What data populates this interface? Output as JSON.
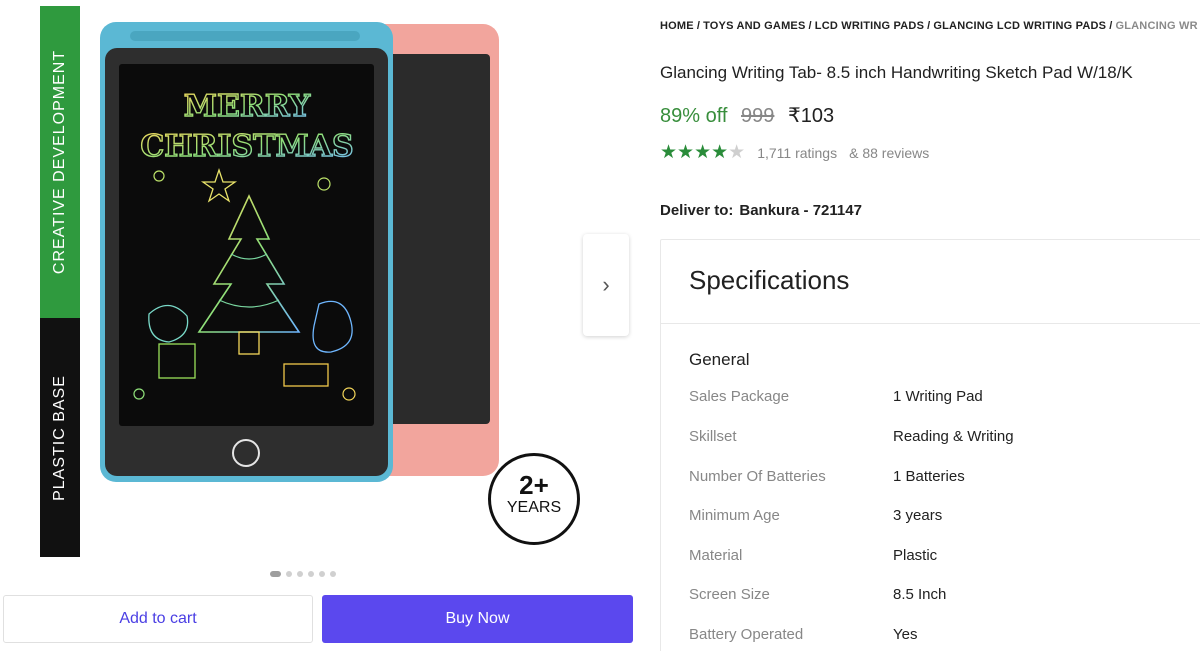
{
  "banner": {
    "top_text": "CREATIVE DEVELOPMENT",
    "bottom_text": "PLASTIC BASE"
  },
  "product_image": {
    "drawing_text_line1": "MERRY",
    "drawing_text_line2": "CHRISTMAS",
    "age_badge_number": "2+",
    "age_badge_label": "YEARS",
    "next_arrow": "›",
    "carousel_dot_count": 6,
    "carousel_active_index": 0
  },
  "actions": {
    "add_to_cart": "Add to cart",
    "buy_now": "Buy Now"
  },
  "breadcrumbs": [
    "HOME",
    "TOYS AND GAMES",
    "LCD WRITING PADS",
    "GLANCING LCD WRITING PADS",
    "GLANCING WR"
  ],
  "product": {
    "title": "Glancing Writing Tab- 8.5 inch Handwriting Sketch Pad W/18/K",
    "discount": "89% off",
    "mrp": "999",
    "price": "₹103",
    "rating_stars": 4,
    "ratings": "1,711 ratings",
    "reviews": "& 88 reviews"
  },
  "delivery": {
    "label": "Deliver to:",
    "location": "Bankura - 721147"
  },
  "specifications": {
    "heading": "Specifications",
    "group": "General",
    "rows": [
      {
        "key": "Sales Package",
        "value": "1 Writing Pad"
      },
      {
        "key": "Skillset",
        "value": "Reading & Writing"
      },
      {
        "key": "Number Of Batteries",
        "value": "1 Batteries"
      },
      {
        "key": "Minimum Age",
        "value": "3 years"
      },
      {
        "key": "Material",
        "value": "Plastic"
      },
      {
        "key": "Screen Size",
        "value": "8.5 Inch"
      },
      {
        "key": "Battery Operated",
        "value": "Yes"
      }
    ]
  },
  "colors": {
    "accent": "#5b48ee",
    "discount_green": "#388e3c",
    "banner_green": "#2f9a3e",
    "tablet_blue": "#5bb8d4",
    "tablet_pink": "#f2a59d"
  }
}
